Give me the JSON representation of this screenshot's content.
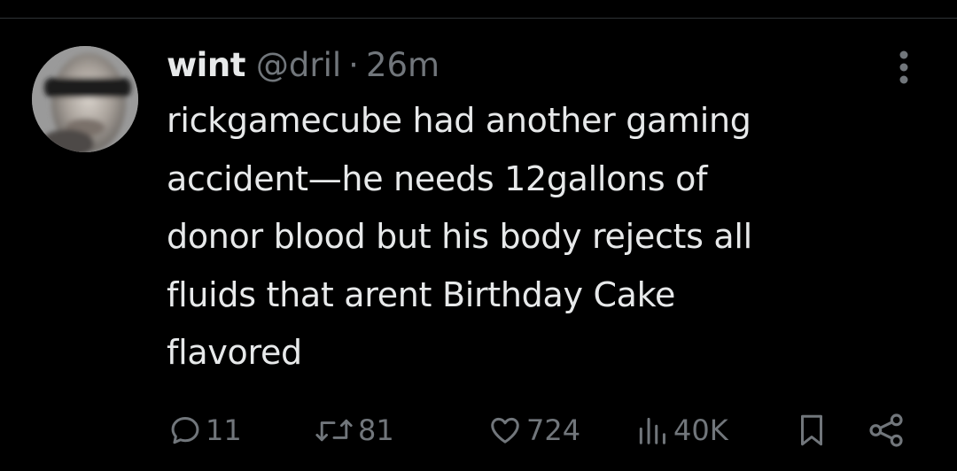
{
  "tweet": {
    "display_name": "wint",
    "handle": "@dril",
    "separator": "·",
    "time": "26m",
    "text_lines": [
      "rickgamecube had another gaming",
      "accident—he needs 12gallons of",
      "donor blood but his body rejects all",
      "fluids that arent Birthday Cake",
      "flavored"
    ]
  },
  "actions": {
    "replies": "11",
    "reposts": "81",
    "likes": "724",
    "views": "40K"
  },
  "icons": {
    "more": "more-vertical-icon",
    "reply": "reply-icon",
    "repost": "repost-icon",
    "like": "heart-icon",
    "views": "views-icon",
    "bookmark": "bookmark-icon",
    "share": "share-icon"
  },
  "colors": {
    "background": "#000000",
    "primary_text": "#e7e9ea",
    "secondary_text": "#71767b",
    "divider": "#2f3336"
  }
}
